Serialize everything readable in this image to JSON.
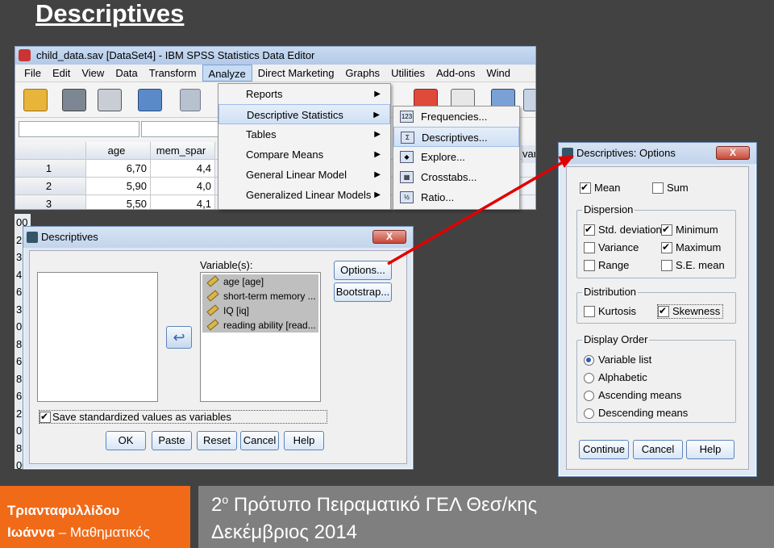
{
  "slide": {
    "title": "Descriptives",
    "footer_author_line1": "Τριανταφυλλίδου",
    "footer_author_name": "Ιωάννα",
    "footer_author_role": "– Μαθηματικός",
    "footer_school_prefix": "2",
    "footer_school_sup": "ο",
    "footer_school_rest": " Πρότυπο Πειραματικό ΓΕΛ Θεσ/κης",
    "footer_date": "Δεκέμβριος 2014"
  },
  "editor": {
    "title": "child_data.sav [DataSet4] - IBM SPSS Statistics Data Editor",
    "menu": [
      "File",
      "Edit",
      "View",
      "Data",
      "Transform",
      "Analyze",
      "Direct Marketing",
      "Graphs",
      "Utilities",
      "Add-ons",
      "Wind"
    ],
    "grid_headers": [
      "age",
      "mem_spar"
    ],
    "rows": [
      {
        "num": "1",
        "age": "6,70",
        "mem": "4,4"
      },
      {
        "num": "2",
        "age": "5,90",
        "mem": "4,0"
      },
      {
        "num": "3",
        "age": "5,50",
        "mem": "4,1"
      }
    ],
    "right_fragment": "var"
  },
  "analyze_menu": [
    "Reports",
    "Descriptive Statistics",
    "Tables",
    "Compare Means",
    "General Linear Model",
    "Generalized Linear Models"
  ],
  "desc_submenu": [
    {
      "label": "Frequencies...",
      "icon": "123"
    },
    {
      "label": "Descriptives...",
      "icon": "Σ"
    },
    {
      "label": "Explore...",
      "icon": "◆"
    },
    {
      "label": "Crosstabs...",
      "icon": "▦"
    },
    {
      "label": "Ratio...",
      "icon": "½"
    }
  ],
  "left_strip": [
    "00",
    "2",
    "3",
    "4",
    "6",
    "3",
    "0",
    "8",
    "6",
    "8",
    "6",
    "2",
    "0",
    "8",
    "00"
  ],
  "descriptives": {
    "title": "Descriptives",
    "close": "X",
    "variables_label": "Variable(s):",
    "variables": [
      "age [age]",
      "short-term memory ...",
      "IQ [iq]",
      "reading ability [read..."
    ],
    "options": "Options...",
    "bootstrap": "Bootstrap...",
    "save_std": "Save standardized values as variables",
    "buttons": [
      "OK",
      "Paste",
      "Reset",
      "Cancel",
      "Help"
    ]
  },
  "options": {
    "title": "Descriptives: Options",
    "close": "X",
    "mean": "Mean",
    "sum": "Sum",
    "dispersion": "Dispersion",
    "std": "Std. deviation",
    "minimum": "Minimum",
    "variance": "Variance",
    "maximum": "Maximum",
    "range": "Range",
    "se_mean": "S.E. mean",
    "distribution": "Distribution",
    "kurtosis": "Kurtosis",
    "skewness": "Skewness",
    "display_order": "Display Order",
    "orders": [
      "Variable list",
      "Alphabetic",
      "Ascending means",
      "Descending means"
    ],
    "buttons": [
      "Continue",
      "Cancel",
      "Help"
    ]
  },
  "colors": {
    "accent_orange": "#f06a18",
    "arrow_red": "#e00000",
    "footer_grey": "#7f7f7f"
  }
}
